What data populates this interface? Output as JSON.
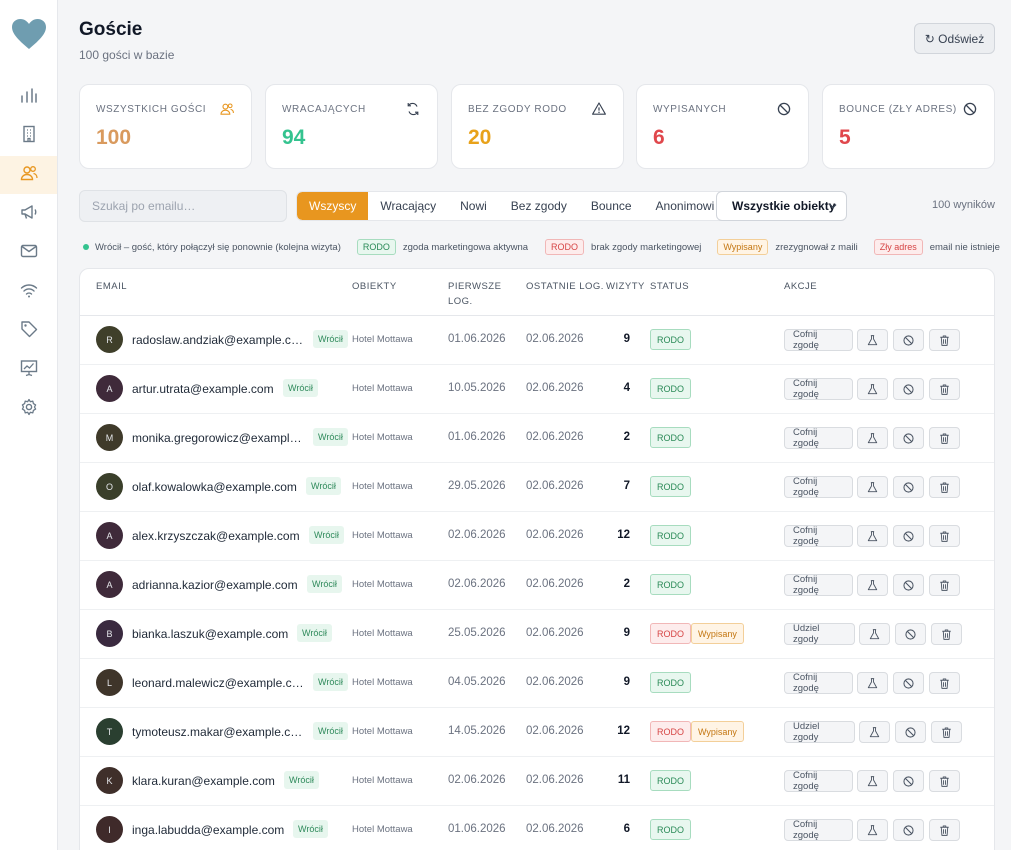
{
  "colors": {
    "accent": "#e8961f",
    "stat_orange": "#d99a5e",
    "stat_green": "#34c38f",
    "stat_amber": "#e8a21a",
    "stat_red": "#e0474c"
  },
  "sidebar": {
    "logo_icon": "heart-icon",
    "items": [
      {
        "icon": "bar-chart-icon",
        "active": false
      },
      {
        "icon": "building-icon",
        "active": false
      },
      {
        "icon": "users-icon",
        "active": true
      },
      {
        "icon": "megaphone-icon",
        "active": false
      },
      {
        "icon": "mail-icon",
        "active": false
      },
      {
        "icon": "wifi-icon",
        "active": false
      },
      {
        "icon": "tag-icon",
        "active": false
      },
      {
        "icon": "presentation-icon",
        "active": false
      },
      {
        "icon": "settings-icon",
        "active": false
      }
    ]
  },
  "header": {
    "title": "Goście",
    "subtitle": "100 gości w bazie",
    "refresh_label": "↻ Odśwież"
  },
  "stats": [
    {
      "label": "Wszystkich gości",
      "value": "100",
      "icon": "users-icon",
      "color": "#d99a5e"
    },
    {
      "label": "Wracających",
      "value": "94",
      "icon": "refresh-icon",
      "color": "#34c38f"
    },
    {
      "label": "Bez zgody RODO",
      "value": "20",
      "icon": "warning-icon",
      "color": "#e8a21a"
    },
    {
      "label": "Wypisanych",
      "value": "6",
      "icon": "ban-icon",
      "color": "#e0474c"
    },
    {
      "label": "Bounce (zły adres)",
      "value": "5",
      "icon": "ban-icon",
      "color": "#e0474c"
    }
  ],
  "filters": {
    "search_placeholder": "Szukaj po emailu…",
    "tabs": [
      "Wszyscy",
      "Wracający",
      "Nowi",
      "Bez zgody",
      "Bounce",
      "Anonimowi"
    ],
    "active_tab": "Wszyscy",
    "select_value": "Wszystkie obiekty",
    "results": "100 wyników"
  },
  "legend": {
    "back": "Wrócił – gość, który połączył się ponownie (kolejna wizyta)",
    "rodo_ok_badge": "RODO",
    "rodo_ok_text": "zgoda marketingowa aktywna",
    "rodo_no_badge": "RODO",
    "rodo_no_text": "brak zgody marketingowej",
    "unsub_badge": "Wypisany",
    "unsub_text": "zrezygnował z maili",
    "bounce_badge": "Zły adres",
    "bounce_text": "email nie istnieje"
  },
  "table": {
    "headers": {
      "email": "Email",
      "objects": "Obiekty",
      "first_1": "Pierwsze",
      "first_2": "log.",
      "last": "Ostatnie log.",
      "visits": "Wizyty",
      "status": "Status",
      "actions": "Akcje"
    },
    "back_label": "Wrócił",
    "action_icons": [
      "flask-icon",
      "ban-icon",
      "trash-icon"
    ],
    "rows": [
      {
        "initial": "R",
        "avatar_color": "#3f3f2a",
        "email": "radoslaw.andziak@example.com",
        "object": "Hotel Mottawa",
        "first": "01.06.2026",
        "last": "02.06.2026",
        "visits": "9",
        "rodo": "ok",
        "rodo_label": "RODO",
        "unsub": false,
        "action": "Cofnij zgodę"
      },
      {
        "initial": "A",
        "avatar_color": "#3f2a3a",
        "email": "artur.utrata@example.com",
        "object": "Hotel Mottawa",
        "first": "10.05.2026",
        "last": "02.06.2026",
        "visits": "4",
        "rodo": "ok",
        "rodo_label": "RODO",
        "unsub": false,
        "action": "Cofnij zgodę"
      },
      {
        "initial": "M",
        "avatar_color": "#3f3a2a",
        "email": "monika.gregorowicz@example.com",
        "object": "Hotel Mottawa",
        "first": "01.06.2026",
        "last": "02.06.2026",
        "visits": "2",
        "rodo": "ok",
        "rodo_label": "RODO",
        "unsub": false,
        "action": "Cofnij zgodę"
      },
      {
        "initial": "O",
        "avatar_color": "#3a3f2a",
        "email": "olaf.kowalowka@example.com",
        "object": "Hotel Mottawa",
        "first": "29.05.2026",
        "last": "02.06.2026",
        "visits": "7",
        "rodo": "ok",
        "rodo_label": "RODO",
        "unsub": false,
        "action": "Cofnij zgodę"
      },
      {
        "initial": "A",
        "avatar_color": "#3f2a3a",
        "email": "alex.krzyszczak@example.com",
        "object": "Hotel Mottawa",
        "first": "02.06.2026",
        "last": "02.06.2026",
        "visits": "12",
        "rodo": "ok",
        "rodo_label": "RODO",
        "unsub": false,
        "action": "Cofnij zgodę"
      },
      {
        "initial": "A",
        "avatar_color": "#3f2a3a",
        "email": "adrianna.kazior@example.com",
        "object": "Hotel Mottawa",
        "first": "02.06.2026",
        "last": "02.06.2026",
        "visits": "2",
        "rodo": "ok",
        "rodo_label": "RODO",
        "unsub": false,
        "action": "Cofnij zgodę"
      },
      {
        "initial": "B",
        "avatar_color": "#3a2a3f",
        "email": "bianka.laszuk@example.com",
        "object": "Hotel Mottawa",
        "first": "25.05.2026",
        "last": "02.06.2026",
        "visits": "9",
        "rodo": "no",
        "rodo_label": "RODO",
        "unsub": true,
        "unsub_label": "Wypisany",
        "action": "Udziel zgody"
      },
      {
        "initial": "L",
        "avatar_color": "#3f352a",
        "email": "leonard.malewicz@example.com",
        "object": "Hotel Mottawa",
        "first": "04.05.2026",
        "last": "02.06.2026",
        "visits": "9",
        "rodo": "ok",
        "rodo_label": "RODO",
        "unsub": false,
        "action": "Cofnij zgodę"
      },
      {
        "initial": "T",
        "avatar_color": "#2a3f30",
        "email": "tymoteusz.makar@example.com",
        "object": "Hotel Mottawa",
        "first": "14.05.2026",
        "last": "02.06.2026",
        "visits": "12",
        "rodo": "no",
        "rodo_label": "RODO",
        "unsub": true,
        "unsub_label": "Wypisany",
        "action": "Udziel zgody"
      },
      {
        "initial": "K",
        "avatar_color": "#3f2f2a",
        "email": "klara.kuran@example.com",
        "object": "Hotel Mottawa",
        "first": "02.06.2026",
        "last": "02.06.2026",
        "visits": "11",
        "rodo": "ok",
        "rodo_label": "RODO",
        "unsub": false,
        "action": "Cofnij zgodę"
      },
      {
        "initial": "I",
        "avatar_color": "#3f2a2a",
        "email": "inga.labudda@example.com",
        "object": "Hotel Mottawa",
        "first": "01.06.2026",
        "last": "02.06.2026",
        "visits": "6",
        "rodo": "ok",
        "rodo_label": "RODO",
        "unsub": false,
        "action": "Cofnij zgodę"
      }
    ]
  }
}
